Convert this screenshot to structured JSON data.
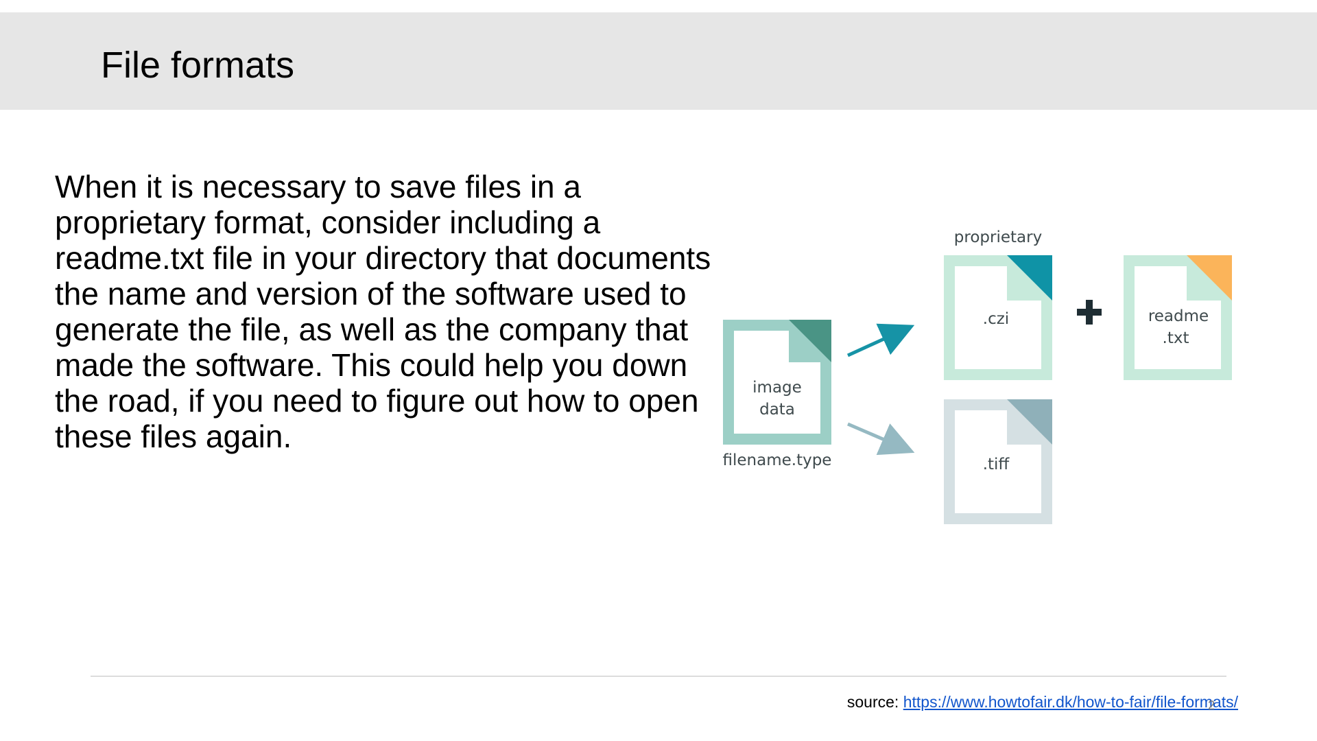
{
  "slide": {
    "title": "File formats",
    "body": "When it is necessary to save files in a proprietary format, consider including a readme.txt file in your directory that documents the name and version of the software used to generate the file, as well as the company that made the software. This could help you down the road, if you need to figure out how to open these files again.",
    "source_prefix": "source: ",
    "source_link": "https://www.howtofair.dk/how-to-fair/file-formats/",
    "page_number": "2"
  },
  "diagram": {
    "source_file_line1": "image",
    "source_file_line2": "data",
    "source_file_caption": "filename.type",
    "proprietary_caption": "proprietary",
    "czi_label": ".czi",
    "plus_icon": "plus-icon",
    "readme_line1": "readme",
    "readme_line2": ".txt",
    "tiff_label": ".tiff",
    "colors": {
      "source_file": "#9ccfc6",
      "source_corner": "#4a9485",
      "czi_file": "#c7eadb",
      "czi_corner": "#0f93a6",
      "readme_file": "#c7eadb",
      "readme_corner": "#fbb45a",
      "tiff_file": "#d5e0e3",
      "tiff_corner": "#8fb0b9",
      "arrow_up": "#1693a6",
      "arrow_down": "#95b9c2",
      "plus": "#1e2d33",
      "label_text": "#3f4a4d"
    }
  }
}
